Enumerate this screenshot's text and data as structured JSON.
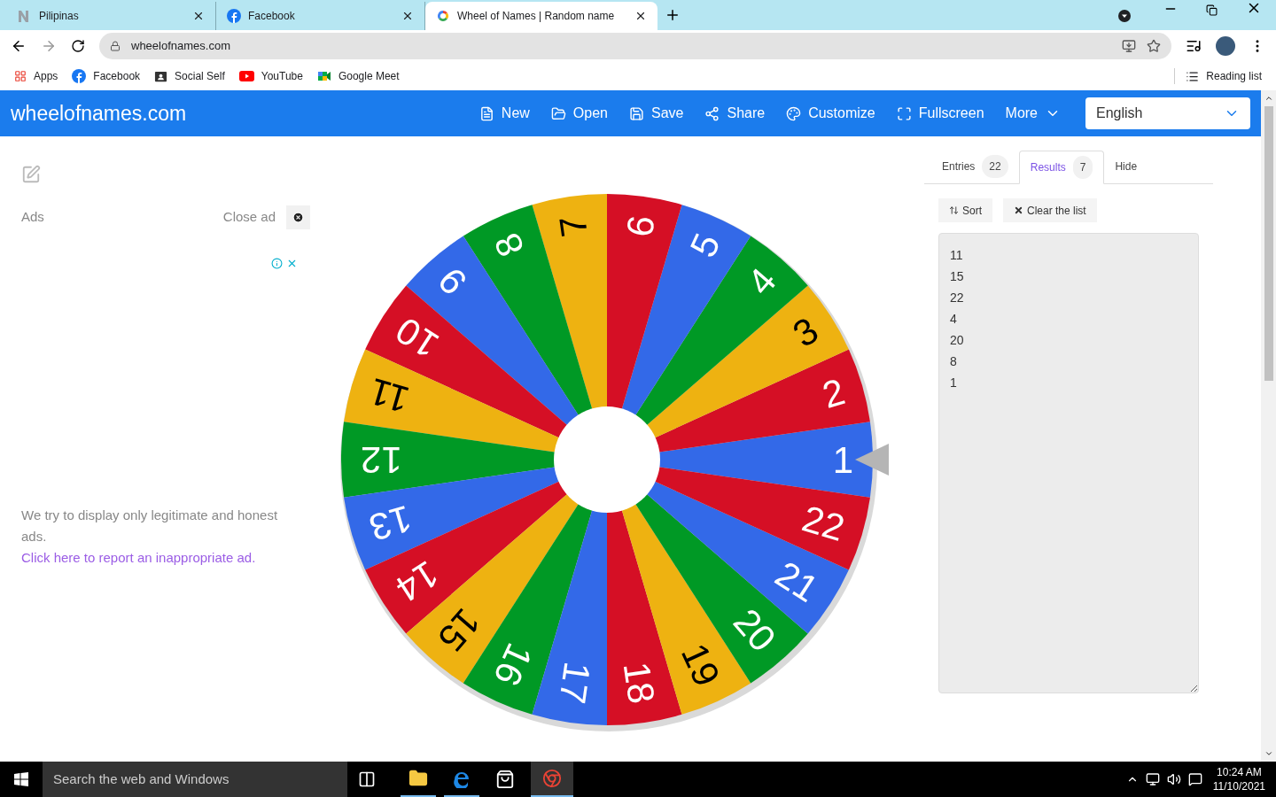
{
  "browser": {
    "tabs": [
      {
        "title": "Pilipinas",
        "selected": false
      },
      {
        "title": "Facebook",
        "selected": false
      },
      {
        "title": "Wheel of Names | Random name",
        "selected": true
      }
    ],
    "address": "wheelofnames.com",
    "bookmarks": [
      "Apps",
      "Facebook",
      "Social Self",
      "YouTube",
      "Google Meet"
    ],
    "reading_list": "Reading list"
  },
  "header": {
    "brand": "wheelofnames.com",
    "nav": [
      "New",
      "Open",
      "Save",
      "Share",
      "Customize",
      "Fullscreen",
      "More"
    ],
    "language": "English"
  },
  "ads": {
    "label": "Ads",
    "close": "Close ad",
    "notice": "We try to display only legitimate and honest ads.",
    "report_link": "Click here to report an inappropriate ad."
  },
  "wheel": {
    "segments": [
      {
        "label": "1",
        "color": "#3369e8"
      },
      {
        "label": "2",
        "color": "#d50f25"
      },
      {
        "label": "3",
        "color": "#eeb211"
      },
      {
        "label": "4",
        "color": "#009925"
      },
      {
        "label": "5",
        "color": "#3369e8"
      },
      {
        "label": "6",
        "color": "#d50f25"
      },
      {
        "label": "7",
        "color": "#eeb211"
      },
      {
        "label": "8",
        "color": "#009925"
      },
      {
        "label": "9",
        "color": "#3369e8"
      },
      {
        "label": "10",
        "color": "#d50f25"
      },
      {
        "label": "11",
        "color": "#eeb211"
      },
      {
        "label": "12",
        "color": "#009925"
      },
      {
        "label": "13",
        "color": "#3369e8"
      },
      {
        "label": "14",
        "color": "#d50f25"
      },
      {
        "label": "15",
        "color": "#eeb211"
      },
      {
        "label": "16",
        "color": "#009925"
      },
      {
        "label": "17",
        "color": "#3369e8"
      },
      {
        "label": "18",
        "color": "#d50f25"
      },
      {
        "label": "19",
        "color": "#eeb211"
      },
      {
        "label": "20",
        "color": "#009925"
      },
      {
        "label": "21",
        "color": "#3369e8"
      },
      {
        "label": "22",
        "color": "#d50f25"
      }
    ]
  },
  "panel": {
    "tabs": [
      {
        "label": "Entries",
        "count": "22",
        "selected": false
      },
      {
        "label": "Results",
        "count": "7",
        "selected": true
      },
      {
        "label": "Hide",
        "selected": false
      }
    ],
    "buttons": [
      "Sort",
      "Clear the list"
    ],
    "results": [
      "11",
      "15",
      "22",
      "4",
      "20",
      "8",
      "1"
    ]
  },
  "taskbar": {
    "search_placeholder": "Search the web and Windows",
    "time": "10:24 AM",
    "date": "11/10/2021"
  }
}
